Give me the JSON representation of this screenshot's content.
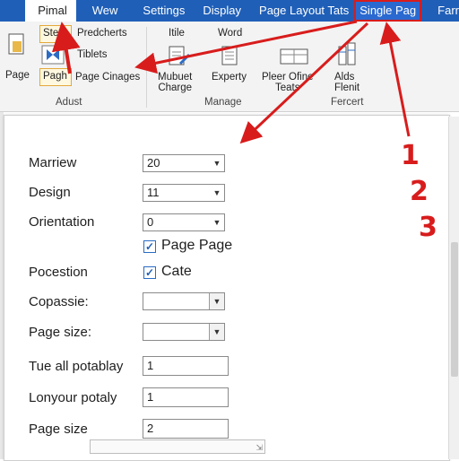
{
  "tabs": [
    {
      "label": "Pimal"
    },
    {
      "label": "Wew"
    },
    {
      "label": "Settings"
    },
    {
      "label": "Display"
    },
    {
      "label": "Page Layout Tats"
    },
    {
      "label": "Single Pag"
    },
    {
      "label": "Farr"
    }
  ],
  "ribbon": {
    "page_label": "Page",
    "stets_label": "Stets",
    "pagh_label": "Pagh",
    "predcherts_label": "Predcherts",
    "tiblets_label": "Tiblets",
    "page_cinages_label": "Page Cinages",
    "group_adust": "Adust",
    "itile_label": "Itile",
    "word_label": "Word",
    "mubuet_label": "Mubuet\nCharge",
    "experty_label": "Experty",
    "pleer_label": "Pleer Ofine\nTeats",
    "alds_label": "Alds\nFlenit",
    "group_manage": "Manage",
    "group_fercert": "Fercert"
  },
  "form": {
    "marriew": {
      "label": "Marriew",
      "value": "20"
    },
    "design": {
      "label": "Design",
      "value": "11"
    },
    "orientation": {
      "label": "Orientation",
      "value": "0"
    },
    "page_page_check": {
      "label": "Page Page",
      "checked": true
    },
    "pocestion": {
      "label": "Pocestion"
    },
    "cate_check": {
      "label": "Cate",
      "checked": true
    },
    "copassie": {
      "label": "Copassie:",
      "value": ""
    },
    "page_size_a": {
      "label": "Page size:",
      "value": ""
    },
    "tue_all": {
      "label": "Tue all potablay",
      "value": "1"
    },
    "lonyour": {
      "label": "Lonyour potaly",
      "value": "1"
    },
    "page_size_b": {
      "label": "Page size",
      "value": "2"
    }
  },
  "annotations": {
    "step1": "1",
    "step2": "2",
    "step3": "3",
    "color": "#d81c1c"
  },
  "colors": {
    "tab_bar": "#1f5fb8",
    "ribbon_bg": "#f3f3f3",
    "accent": "#2b6cc4"
  }
}
